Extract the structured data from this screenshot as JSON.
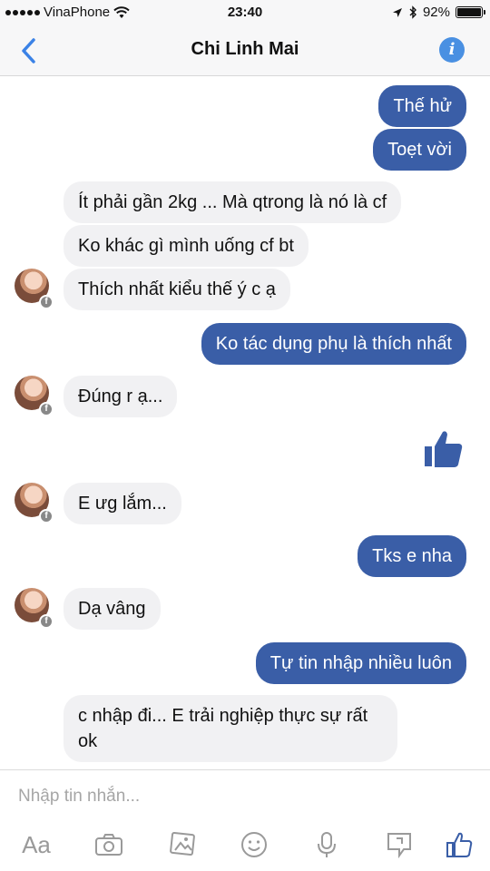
{
  "status_bar": {
    "carrier": "VinaPhone",
    "time": "23:40",
    "battery": "92%",
    "battery_level": 0.92
  },
  "header": {
    "title": "Chi Linh Mai",
    "info_glyph": "i"
  },
  "messages": [
    {
      "from": "me",
      "text": "Thế hử"
    },
    {
      "from": "me",
      "text": "Toẹt vời"
    },
    {
      "from": "them",
      "text": "Ít phải gần 2kg ... Mà qtrong là nó là cf"
    },
    {
      "from": "them",
      "text": "Ko khác gì mình uống cf bt"
    },
    {
      "from": "them",
      "text": "Thích nhất kiểu thế ý c ạ"
    },
    {
      "from": "me",
      "text": "Ko tác dụng phụ là thích nhất"
    },
    {
      "from": "them",
      "text": "Đúng r ạ..."
    },
    {
      "from": "me",
      "type": "like-sticker",
      "icon": "thumbs-up-icon"
    },
    {
      "from": "them",
      "text": "E ưg lắm..."
    },
    {
      "from": "me",
      "text": "Tks e nha"
    },
    {
      "from": "them",
      "text": "Dạ vâng"
    },
    {
      "from": "me",
      "text": "Tự tin nhập nhiều luôn"
    },
    {
      "from": "them",
      "text": "c nhập đi... E trải nghiệp thực sự rất ok"
    }
  ],
  "composer": {
    "placeholder": "Nhập tin nhắn...",
    "text_format_label": "Aa",
    "tools": [
      "text-format-icon",
      "camera-icon",
      "gallery-icon",
      "emoji-icon",
      "microphone-icon",
      "sticker-icon",
      "like-icon"
    ]
  },
  "colors": {
    "outgoing_bubble": "#3a5ea7",
    "incoming_bubble": "#f1f1f3",
    "accent": "#4a90e2"
  }
}
